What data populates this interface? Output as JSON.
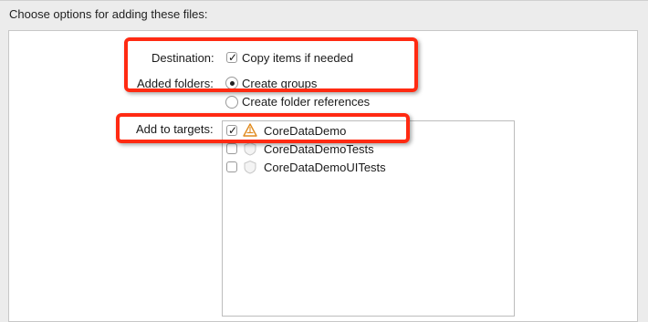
{
  "header": {
    "title": "Choose options for adding these files:"
  },
  "destination": {
    "label": "Destination:",
    "option_label": "Copy items if needed",
    "checked": true
  },
  "added_folders": {
    "label": "Added folders:",
    "options": [
      {
        "label": "Create groups",
        "selected": true
      },
      {
        "label": "Create folder references",
        "selected": false
      }
    ]
  },
  "targets": {
    "label": "Add to targets:",
    "items": [
      {
        "name": "CoreDataDemo",
        "checked": true,
        "icon": "app-target-icon"
      },
      {
        "name": "CoreDataDemoTests",
        "checked": false,
        "icon": "test-target-icon"
      },
      {
        "name": "CoreDataDemoUITests",
        "checked": false,
        "icon": "test-target-icon"
      }
    ]
  },
  "colors": {
    "highlight": "#ff2a12",
    "window_background": "#ececec",
    "panel_background": "#ffffff"
  }
}
